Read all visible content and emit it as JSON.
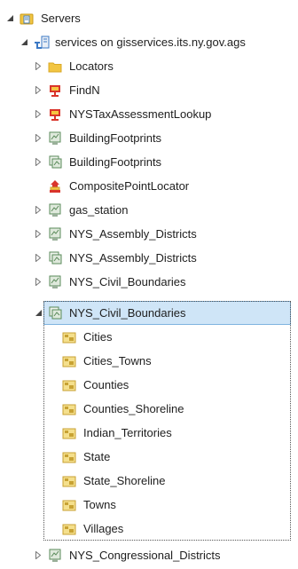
{
  "tree": {
    "root": {
      "label": "Servers",
      "icon": "server-folder-icon"
    },
    "connection": {
      "label": "services on gisservices.its.ny.gov.ags",
      "icon": "ags-connection-icon"
    },
    "items": [
      {
        "label": "Locators",
        "icon": "folder-icon"
      },
      {
        "label": "FindN",
        "icon": "geoprocessing-service-icon"
      },
      {
        "label": "NYSTaxAssessmentLookup",
        "icon": "geoprocessing-service-icon"
      },
      {
        "label": "BuildingFootprints",
        "icon": "map-service-icon"
      },
      {
        "label": "BuildingFootprints",
        "icon": "feature-service-icon"
      },
      {
        "label": "CompositePointLocator",
        "icon": "geocode-service-icon"
      },
      {
        "label": "gas_station",
        "icon": "map-service-icon"
      },
      {
        "label": "NYS_Assembly_Districts",
        "icon": "map-service-icon"
      },
      {
        "label": "NYS_Assembly_Districts",
        "icon": "feature-service-icon"
      },
      {
        "label": "NYS_Civil_Boundaries",
        "icon": "map-service-icon"
      },
      {
        "label": "NYS_Civil_Boundaries",
        "icon": "feature-service-icon"
      }
    ],
    "layers": [
      {
        "label": "Cities",
        "icon": "polygon-layer-icon"
      },
      {
        "label": "Cities_Towns",
        "icon": "polygon-layer-icon"
      },
      {
        "label": "Counties",
        "icon": "polygon-layer-icon"
      },
      {
        "label": "Counties_Shoreline",
        "icon": "polygon-layer-icon"
      },
      {
        "label": "Indian_Territories",
        "icon": "polygon-layer-icon"
      },
      {
        "label": "State",
        "icon": "polygon-layer-icon"
      },
      {
        "label": "State_Shoreline",
        "icon": "polygon-layer-icon"
      },
      {
        "label": "Towns",
        "icon": "polygon-layer-icon"
      },
      {
        "label": "Villages",
        "icon": "polygon-layer-icon"
      }
    ],
    "last": {
      "label": "NYS_Congressional_Districts",
      "icon": "map-service-icon"
    }
  },
  "colors": {
    "selection_bg": "#cfe5f7",
    "selection_border": "#7fb4e0",
    "folder": "#f2c542",
    "gp_red": "#d9342b",
    "map_green": "#5a8a5a",
    "layer_gold": "#c8a233"
  }
}
